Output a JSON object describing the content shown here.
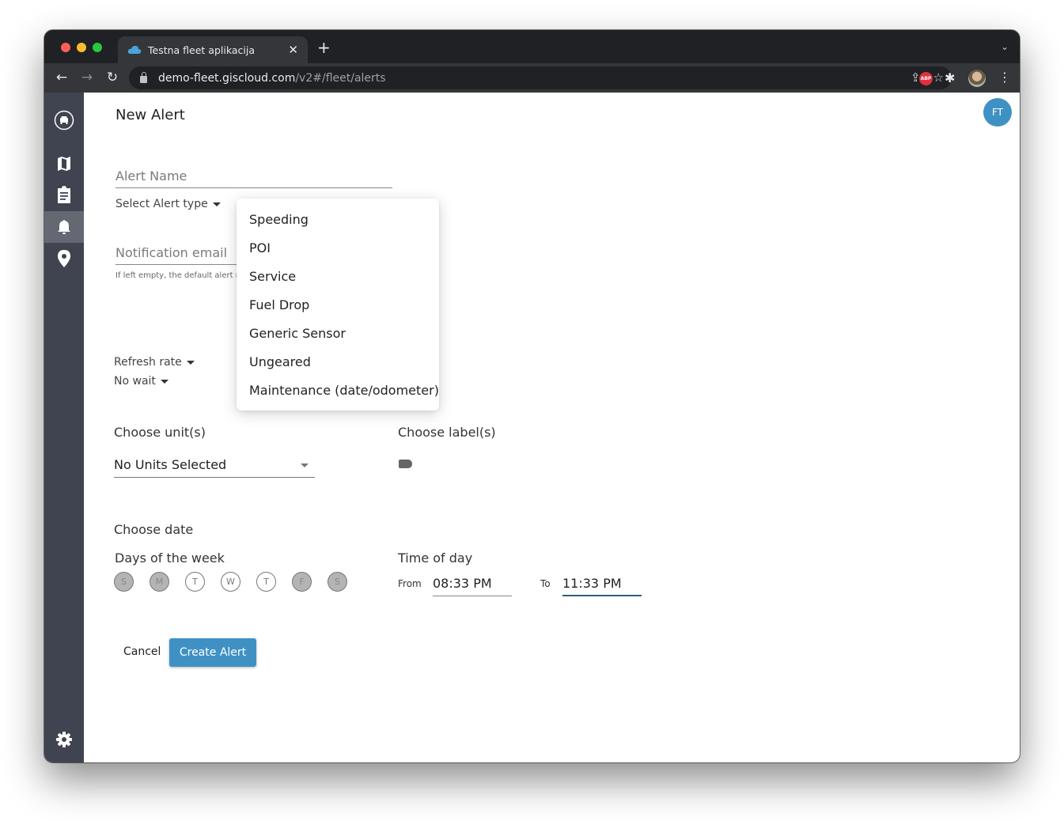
{
  "browser": {
    "tab_title": "Testna fleet aplikacija",
    "tab_close": "✕",
    "new_tab": "+",
    "tab_list": "⌄",
    "url_host": "demo-fleet.giscloud.com",
    "url_path": "/v2#/fleet/alerts",
    "nav_back": "←",
    "nav_forward": "→",
    "nav_reload": "↻",
    "share_icon": "⇪",
    "bookmark_icon": "☆",
    "abp_label": "ABP",
    "puzzle_icon": "✱",
    "menu_icon": "⋮"
  },
  "sidebar": {
    "items": [
      {
        "name": "vehicles",
        "active": false
      },
      {
        "name": "map",
        "active": false
      },
      {
        "name": "reports",
        "active": false
      },
      {
        "name": "alerts",
        "active": true
      },
      {
        "name": "places",
        "active": false
      },
      {
        "name": "settings",
        "active": false
      }
    ]
  },
  "header": {
    "title": "New Alert",
    "user_initials": "FT"
  },
  "form": {
    "alert_name_placeholder": "Alert Name",
    "alert_type_label": "Select Alert type",
    "notification_email_placeholder": "Notification email",
    "helper_text": "If left empty, the default alert nar",
    "refresh_rate_label": "Refresh rate",
    "wait_label": "No wait",
    "units_label": "Choose unit(s)",
    "units_value": "No Units Selected",
    "labels_label": "Choose label(s)",
    "date_label": "Choose date",
    "days_label": "Days of the week",
    "days": [
      {
        "letter": "S",
        "selected": true
      },
      {
        "letter": "M",
        "selected": true
      },
      {
        "letter": "T",
        "selected": false
      },
      {
        "letter": "W",
        "selected": false
      },
      {
        "letter": "T",
        "selected": false
      },
      {
        "letter": "F",
        "selected": true
      },
      {
        "letter": "S",
        "selected": true
      }
    ],
    "time_label": "Time of day",
    "from_label": "From",
    "from_value": "08:33 PM",
    "to_label": "To",
    "to_value": "11:33 PM"
  },
  "actions": {
    "cancel": "Cancel",
    "create": "Create Alert"
  },
  "alert_type_dropdown": {
    "options": [
      "Speeding",
      "POI",
      "Service",
      "Fuel Drop",
      "Generic Sensor",
      "Ungeared",
      "Maintenance (date/odometer)"
    ]
  }
}
